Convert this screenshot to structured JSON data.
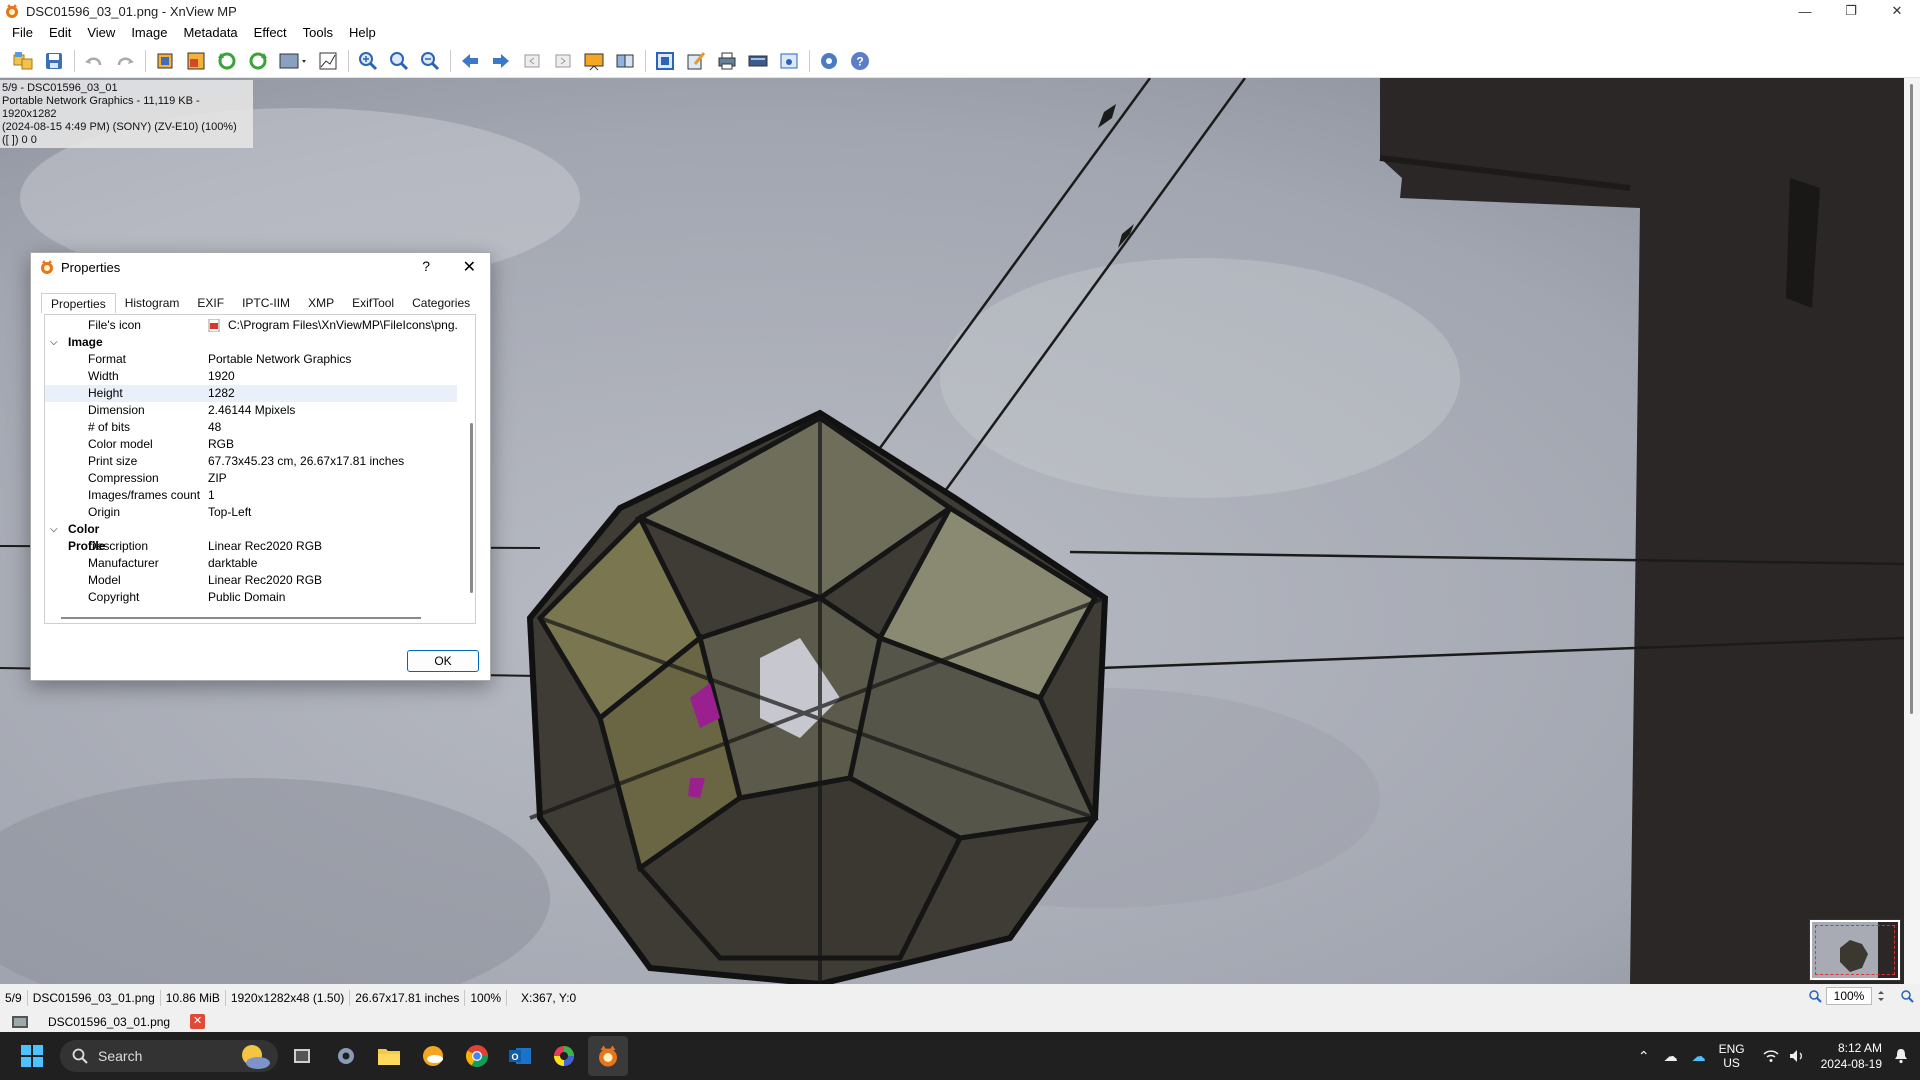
{
  "window": {
    "title": "DSC01596_03_01.png - XnView MP",
    "minimize": "—",
    "maximize": "❐",
    "close": "✕"
  },
  "menu": [
    "File",
    "Edit",
    "View",
    "Image",
    "Metadata",
    "Effect",
    "Tools",
    "Help"
  ],
  "toolbar_icons": [
    "browse-icon",
    "save-icon",
    "undo-icon",
    "redo-icon",
    "crop-icon",
    "resize-icon",
    "rotate-left-icon",
    "rotate-right-icon",
    "adjust-icon",
    "levels-icon",
    "zoom-in-icon",
    "zoom-fit-icon",
    "zoom-out-icon",
    "prev-arrow-icon",
    "next-arrow-icon",
    "first-icon",
    "last-icon",
    "slideshow-icon",
    "compare-icon",
    "fullscreen-icon",
    "edit-icon",
    "print-icon",
    "scanner-icon",
    "screenshot-icon",
    "settings-icon",
    "help-icon"
  ],
  "overlay": {
    "line1": "5/9 - DSC01596_03_01",
    "line2": "Portable Network Graphics - 11,119 KB - 1920x1282",
    "line3": "(2024-08-15 4:49 PM) (SONY) (ZV-E10) (100%)",
    "line4": "([ ]) 0 0"
  },
  "dialog": {
    "title": "Properties",
    "help": "?",
    "close": "✕",
    "tabs": [
      "Properties",
      "Histogram",
      "EXIF",
      "IPTC-IIM",
      "XMP",
      "ExifTool",
      "Categories"
    ],
    "file_icon_label": "File's icon",
    "file_icon_value": "C:\\Program Files\\XnViewMP\\FileIcons\\png.",
    "image_section": "Image",
    "image_props": [
      {
        "k": "Format",
        "v": "Portable Network Graphics"
      },
      {
        "k": "Width",
        "v": "1920"
      },
      {
        "k": "Height",
        "v": "1282"
      },
      {
        "k": "Dimension",
        "v": "2.46144 Mpixels"
      },
      {
        "k": "# of bits",
        "v": "48"
      },
      {
        "k": "Color model",
        "v": "RGB"
      },
      {
        "k": "Print size",
        "v": "67.73x45.23 cm, 26.67x17.81 inches"
      },
      {
        "k": "Compression",
        "v": "ZIP"
      },
      {
        "k": "Images/frames count",
        "v": "1"
      },
      {
        "k": "Origin",
        "v": "Top-Left"
      }
    ],
    "color_section": "Color Profile",
    "color_props": [
      {
        "k": "Description",
        "v": "Linear Rec2020 RGB"
      },
      {
        "k": "Manufacturer",
        "v": "darktable"
      },
      {
        "k": "Model",
        "v": "Linear Rec2020 RGB"
      },
      {
        "k": "Copyright",
        "v": "Public Domain"
      }
    ],
    "ok": "OK"
  },
  "statusbar": {
    "index": "5/9",
    "filename": "DSC01596_03_01.png",
    "filesize": "10.86 MiB",
    "dimensions": "1920x1282x48 (1.50)",
    "printsize": "26.67x17.81 inches",
    "zoom": "100%",
    "coords": "X:367, Y:0",
    "zoom_value": "100%"
  },
  "tabs": {
    "file_tab": "DSC01596_03_01.png",
    "close": "✕"
  },
  "taskbar": {
    "search_label": "Search",
    "lang_line1": "ENG",
    "lang_line2": "US",
    "time": "8:12 AM",
    "date": "2024-08-19"
  },
  "colors": {
    "accent": "#0067c0",
    "taskbar": "#202020",
    "close_badge": "#e04a3a"
  }
}
